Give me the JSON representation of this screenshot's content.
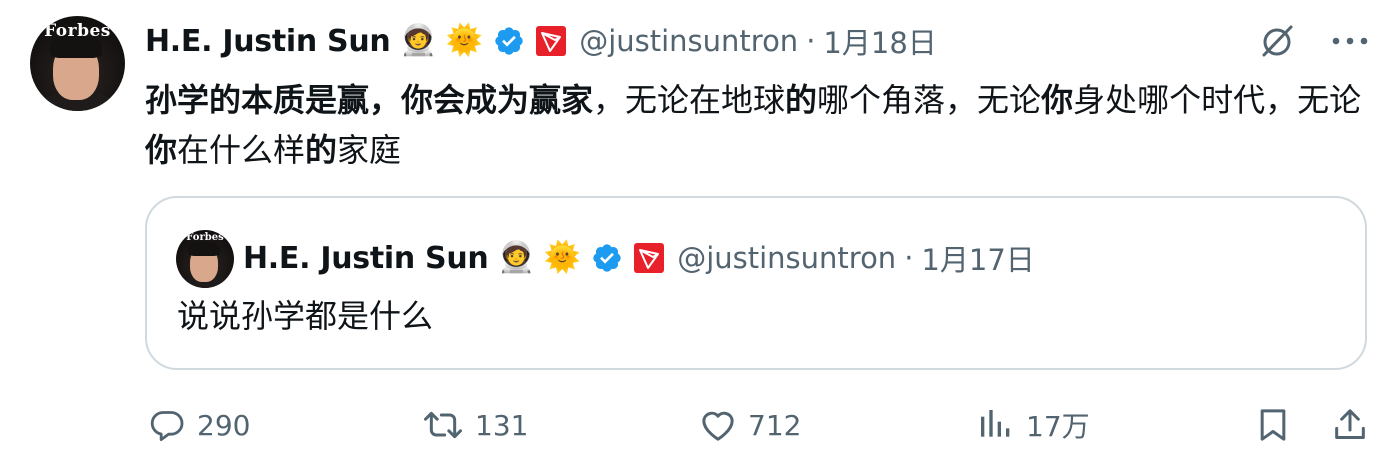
{
  "author": {
    "name": "H.E. Justin Sun",
    "emoji_1": "🧑‍🚀",
    "emoji_2": "🌞",
    "handle": "@justinsuntron",
    "separator": "·",
    "date": "1月18日",
    "avatar_text": "Forbes"
  },
  "body": {
    "segments": [
      {
        "text": "孙学的本质是赢，你会成为赢家",
        "bold": true
      },
      {
        "text": "，无论在地球",
        "bold": false
      },
      {
        "text": "的",
        "bold": true
      },
      {
        "text": "哪个角落，无论",
        "bold": false
      },
      {
        "text": "你",
        "bold": true
      },
      {
        "text": "身处哪个时代，无论",
        "bold": false
      },
      {
        "text": "你",
        "bold": true
      },
      {
        "text": "在什么样",
        "bold": false
      },
      {
        "text": "的",
        "bold": true
      },
      {
        "text": "家庭",
        "bold": false
      }
    ]
  },
  "quote": {
    "name": "H.E. Justin Sun",
    "emoji_1": "🧑‍🚀",
    "emoji_2": "🌞",
    "handle": "@justinsuntron",
    "separator": "·",
    "date": "1月17日",
    "text": "说说孙学都是什么",
    "avatar_text": "Forbes"
  },
  "actions": {
    "replies": "290",
    "retweets": "131",
    "likes": "712",
    "views": "17万"
  },
  "icons": {
    "verified": "verified-badge-icon",
    "tron": "tron-logo-icon",
    "grok": "grok-icon",
    "more": "more-icon",
    "reply": "reply-icon",
    "retweet": "retweet-icon",
    "like": "heart-icon",
    "views": "views-icon",
    "bookmark": "bookmark-icon",
    "share": "share-icon"
  },
  "colors": {
    "text": "#0f1419",
    "secondary": "#536471",
    "verified": "#1d9bf0",
    "tron": "#e8202a",
    "border": "#cfd9de"
  }
}
